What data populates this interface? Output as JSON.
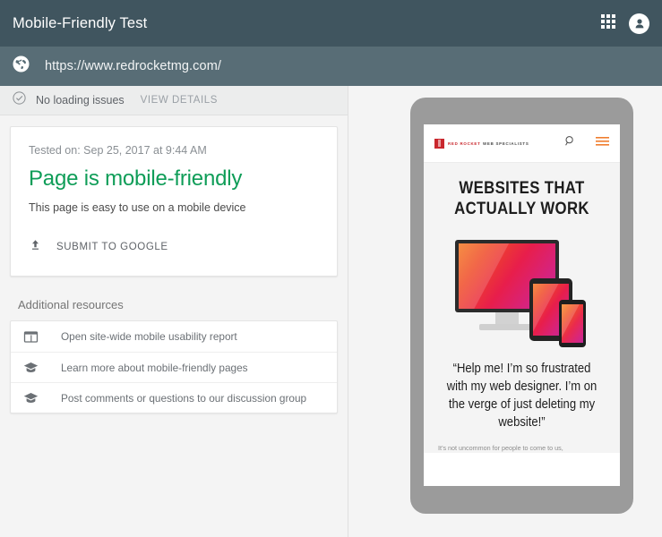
{
  "appbar": {
    "title": "Mobile-Friendly Test",
    "apps_grid_icon": "apps-grid-icon",
    "avatar_icon": "account-avatar-icon"
  },
  "urlbar": {
    "globe_icon": "globe-icon",
    "url": "https://www.redrocketmg.com/"
  },
  "status": {
    "check_icon": "check-circle-icon",
    "text": "No loading issues",
    "view_details": "VIEW DETAILS"
  },
  "result_card": {
    "tested_on": "Tested on: Sep 25, 2017 at 9:44 AM",
    "verdict": "Page is mobile-friendly",
    "verdict_color": "#0f9d58",
    "description": "This page is easy to use on a mobile device",
    "submit_icon": "upload-icon",
    "submit_label": "SUBMIT TO GOOGLE"
  },
  "resources": {
    "title": "Additional resources",
    "items": [
      {
        "icon": "dashboard-report-icon",
        "label": "Open site-wide mobile usability report"
      },
      {
        "icon": "graduation-cap-icon",
        "label": "Learn more about mobile-friendly pages"
      },
      {
        "icon": "graduation-cap-icon",
        "label": "Post comments or questions to our discussion group"
      }
    ]
  },
  "preview": {
    "site_nav": {
      "logo_red": "RED ROCKET",
      "logo_dark": "WEB SPECIALISTS",
      "logo_color": "#c9272d",
      "search_icon": "search-icon",
      "menu_icon": "hamburger-menu-icon",
      "menu_color": "#f07d2e"
    },
    "hero_line1": "WEBSITES THAT",
    "hero_line2": "ACTUALLY WORK",
    "devices_image": "devices-monitor-tablet-phone-image",
    "quote": "“Help me!  I’m so frustrated with my web designer.  I’m on the verge of just deleting my website!”",
    "body_text": "It’s not uncommon for people to come to us,"
  },
  "colors": {
    "appbar_bg": "#40555f",
    "urlbar_bg": "#586d76",
    "device_frame": "#9b9b9b",
    "page_bg": "#f4f4f4"
  }
}
